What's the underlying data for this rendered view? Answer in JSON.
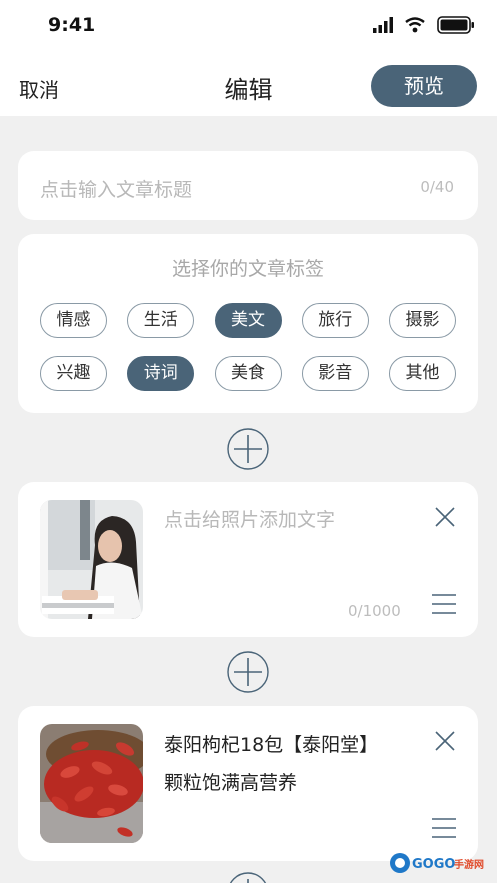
{
  "status": {
    "time": "9:41"
  },
  "nav": {
    "cancel": "取消",
    "title": "编辑",
    "preview": "预览"
  },
  "title_input": {
    "placeholder": "点击输入文章标题",
    "counter": "0/40"
  },
  "tags": {
    "heading": "选择你的文章标签",
    "items": [
      {
        "label": "情感",
        "selected": false
      },
      {
        "label": "生活",
        "selected": false
      },
      {
        "label": "美文",
        "selected": true
      },
      {
        "label": "旅行",
        "selected": false
      },
      {
        "label": "摄影",
        "selected": false
      },
      {
        "label": "兴趣",
        "selected": false
      },
      {
        "label": "诗词",
        "selected": true
      },
      {
        "label": "美食",
        "selected": false
      },
      {
        "label": "影音",
        "selected": false
      },
      {
        "label": "其他",
        "selected": false
      }
    ]
  },
  "photo_block": {
    "placeholder": "点击给照片添加文字",
    "counter": "0/1000"
  },
  "text_block": {
    "line1": "泰阳枸杞18包【泰阳堂】",
    "line2": "颗粒饱满高营养"
  },
  "watermark": {
    "text": "GOGO手游网"
  },
  "colors": {
    "accent": "#4a6478",
    "background": "#f0f0f0",
    "card": "#ffffff"
  },
  "icons": [
    "signal-icon",
    "wifi-icon",
    "battery-icon",
    "plus-circle-icon",
    "close-icon",
    "drag-handle-icon"
  ]
}
